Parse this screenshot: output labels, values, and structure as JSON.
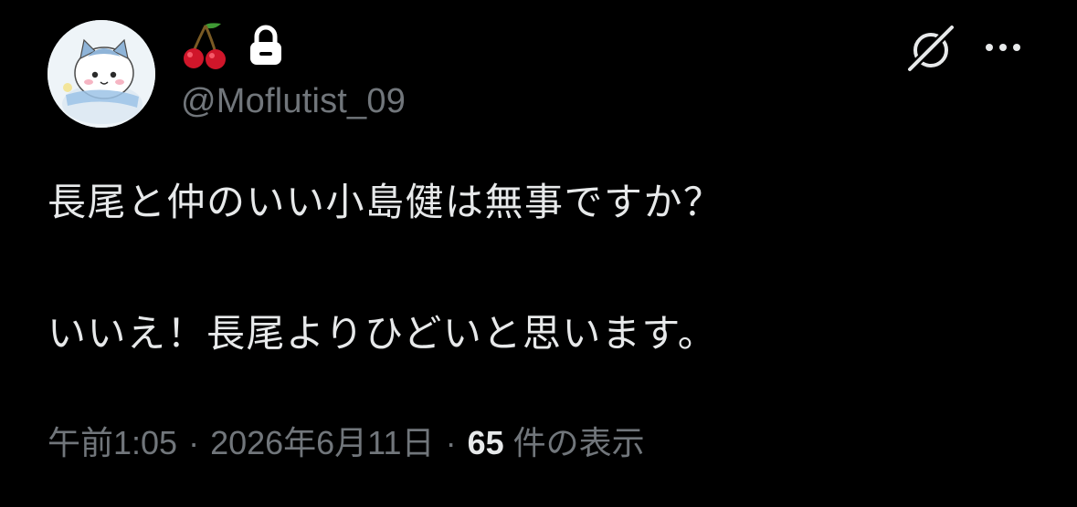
{
  "tweet": {
    "author": {
      "name_icons": [
        "cherries-icon",
        "lock-icon"
      ],
      "handle": "@Moflutist_09",
      "avatar_icon": "chiikawa-hachiware-avatar"
    },
    "header_actions": {
      "grok_icon": "grok-icon",
      "more_icon": "more-icon"
    },
    "body": {
      "line1": "長尾と仲のいい小島健は無事ですか？",
      "line2": "いいえ！長尾よりひどいと思います。"
    },
    "meta": {
      "time": "午前1:05",
      "separator": "·",
      "date": "2026年6月11日",
      "view_count": "65",
      "view_label": "件の表示"
    }
  }
}
